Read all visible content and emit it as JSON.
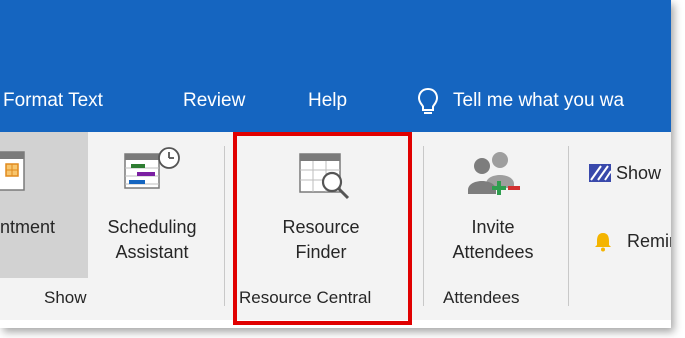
{
  "tabs": [
    {
      "label": "Format Text"
    },
    {
      "label": "Review"
    },
    {
      "label": "Help"
    }
  ],
  "tell_me": {
    "text": "Tell me what you wa"
  },
  "ribbon": {
    "appointment_label": "ntment",
    "scheduling": {
      "line1": "Scheduling",
      "line2": "Assistant"
    },
    "resource_finder": {
      "line1": "Resource",
      "line2": "Finder"
    },
    "invite": {
      "line1": "Invite",
      "line2": "Attendees"
    },
    "show_as": "Show",
    "reminder": "Remir",
    "groups": {
      "show": "Show",
      "resource_central": "Resource Central",
      "attendees": "Attendees"
    }
  },
  "colors": {
    "title_bar": "#1565c0",
    "ribbon_bg": "#f3f3f3",
    "highlight": "#e00000"
  }
}
